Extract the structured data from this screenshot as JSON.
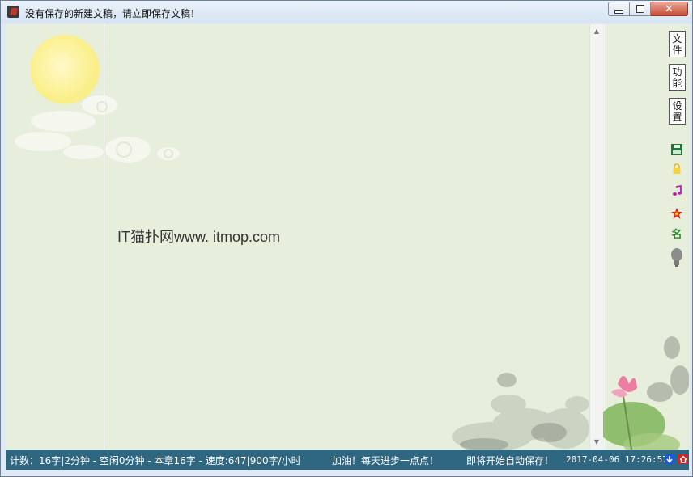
{
  "window": {
    "title": "没有保存的新建文稿，请立即保存文稿！",
    "close_glyph": "✕"
  },
  "editor": {
    "content": "IT猫扑网www. itmop.com"
  },
  "sidebar": {
    "buttons": [
      {
        "label_1": "文",
        "label_2": "件"
      },
      {
        "label_1": "功",
        "label_2": "能"
      },
      {
        "label_1": "设",
        "label_2": "置"
      }
    ],
    "icons": [
      "save-icon",
      "lock-icon",
      "music-icon",
      "star-icon",
      "name-icon",
      "lightbulb-icon"
    ],
    "name_icon_text": "名"
  },
  "scrollbar": {
    "up": "▲",
    "down": "▼"
  },
  "status": {
    "counts": "计数：16字|2分钟 - 空闲0分钟 - 本章16字 - 速度:647|900字/小时",
    "encourage": "加油！每天进步一点点！",
    "autosave": "即将开始自动保存！",
    "datetime": "2017-04-06 17:26:57"
  },
  "colors": {
    "editor_bg": "#e7eedc",
    "status_bg": "#2f6680",
    "moon": "#fbf08f"
  }
}
